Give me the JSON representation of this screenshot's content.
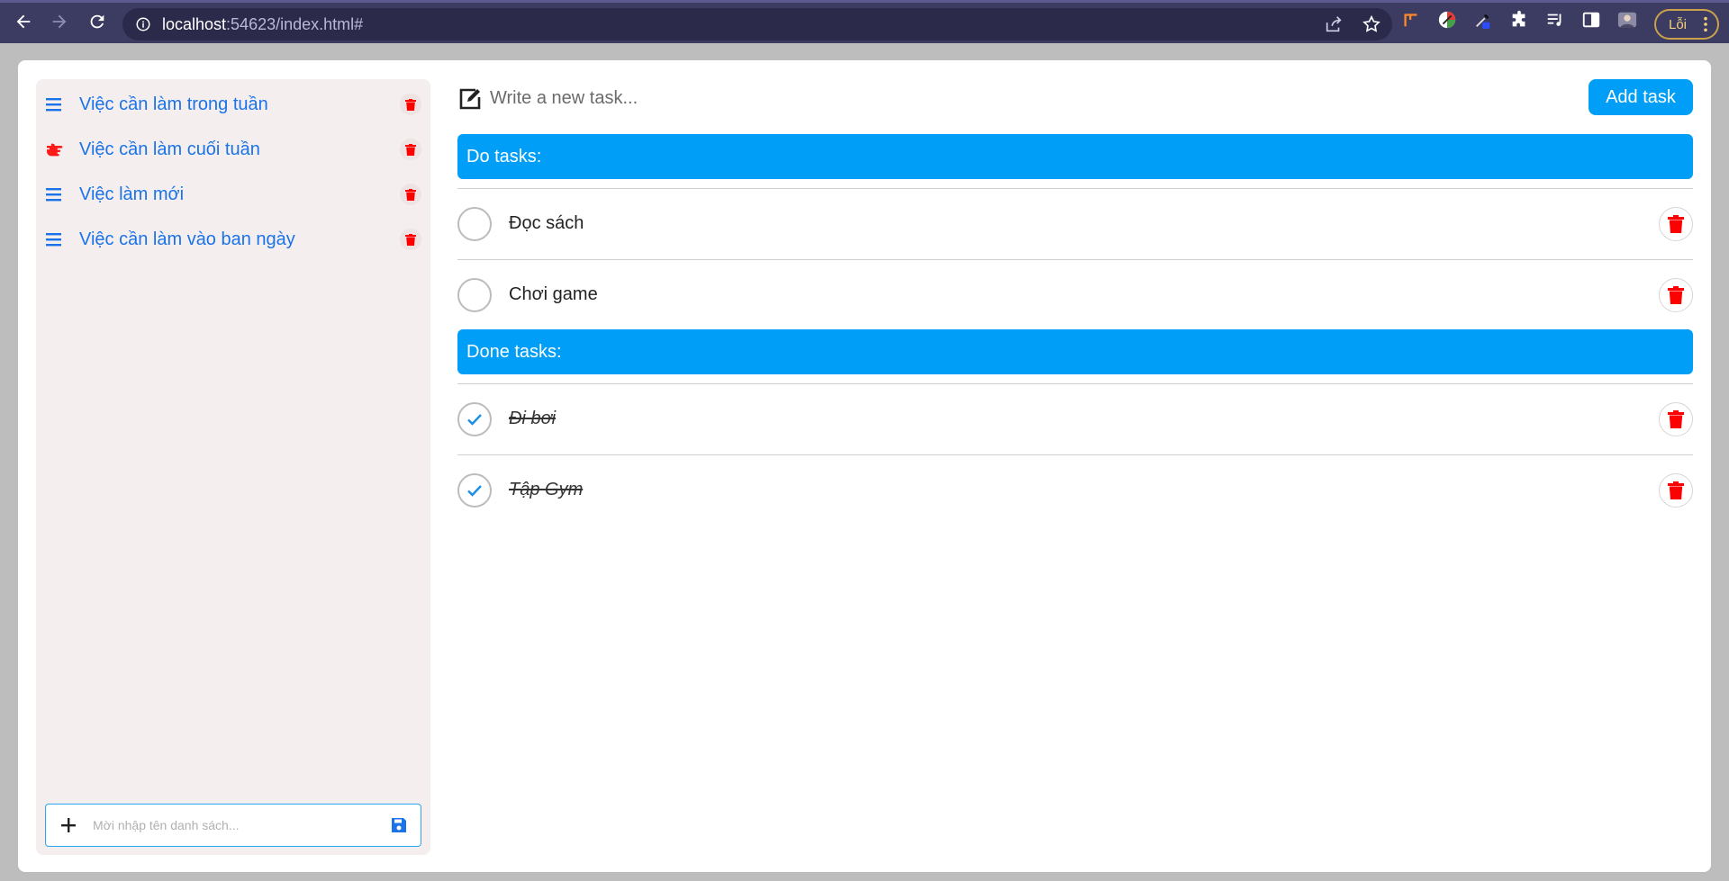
{
  "browser": {
    "url_host": "localhost",
    "url_rest": ":54623/index.html#",
    "profile_label": "Lỗi"
  },
  "sidebar": {
    "items": [
      {
        "label": "Việc cần làm trong tuần",
        "icon": "list-icon"
      },
      {
        "label": "Việc cần làm cuối tuần",
        "icon": "hand-pointing-icon"
      },
      {
        "label": "Việc làm mới",
        "icon": "list-icon"
      },
      {
        "label": "Việc cần làm vào ban ngày",
        "icon": "list-icon"
      }
    ],
    "new_list": {
      "placeholder": "Mời nhập tên danh sách..."
    }
  },
  "main": {
    "task_input": {
      "placeholder": "Write a new task..."
    },
    "add_button": "Add task",
    "do_header": "Do tasks:",
    "done_header": "Done tasks:",
    "do_tasks": [
      {
        "label": "Đọc sách"
      },
      {
        "label": "Chơi game"
      }
    ],
    "done_tasks": [
      {
        "label": "Đi bơi"
      },
      {
        "label": "Tập Gym"
      }
    ]
  },
  "colors": {
    "accent": "#009ef7",
    "link": "#1a73e8",
    "danger": "#ff0000",
    "sidebar_bg": "#f4eeee",
    "browser_bg": "#3c3b61"
  }
}
